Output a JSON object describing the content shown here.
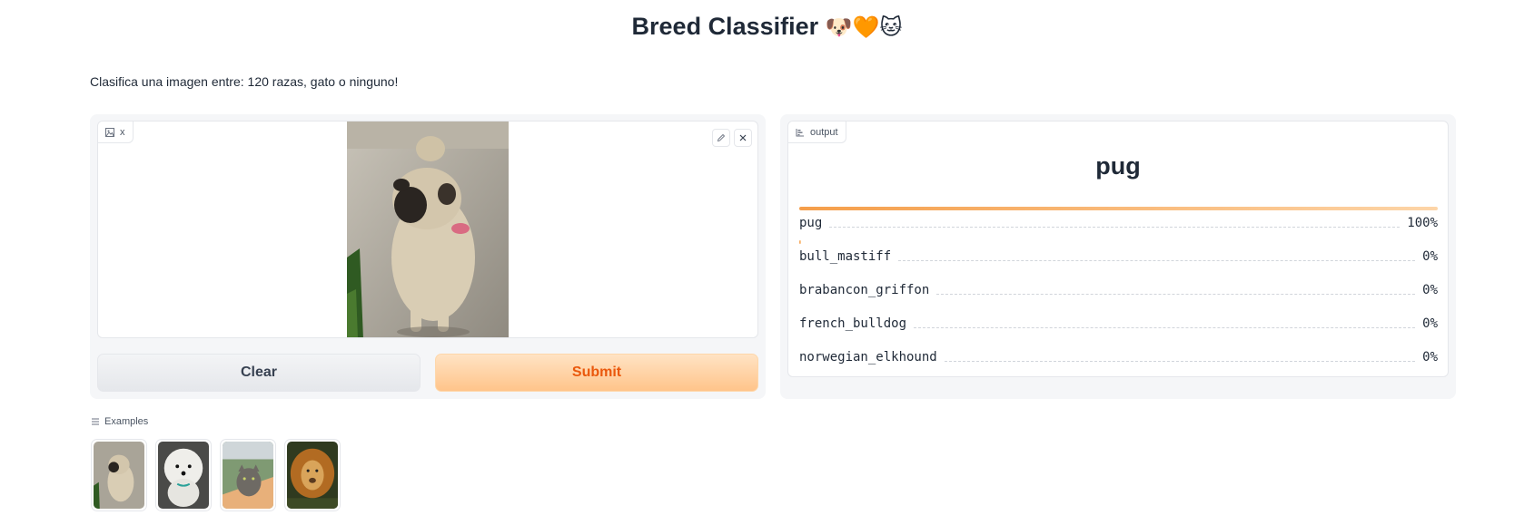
{
  "header": {
    "title": "Breed Classifier",
    "emoji": "🐶🧡🐱"
  },
  "description": "Clasifica una imagen entre: 120 razas, gato o ninguno!",
  "input": {
    "label": "x",
    "edit_icon": "pencil-icon",
    "clear_icon": "close-icon"
  },
  "buttons": {
    "clear": "Clear",
    "submit": "Submit"
  },
  "output": {
    "label": "output",
    "prediction": "pug",
    "confidences": [
      {
        "name": "pug",
        "value": "100%",
        "fraction": 1.0
      },
      {
        "name": "bull_mastiff",
        "value": "0%",
        "fraction": 0.0
      },
      {
        "name": "brabancon_griffon",
        "value": "0%",
        "fraction": 0.0
      },
      {
        "name": "french_bulldog",
        "value": "0%",
        "fraction": 0.0
      },
      {
        "name": "norwegian_elkhound",
        "value": "0%",
        "fraction": 0.0
      }
    ]
  },
  "examples": {
    "label": "Examples",
    "items": [
      "pug",
      "white-dog",
      "cat",
      "lion"
    ]
  },
  "colors": {
    "accent": "#f97316",
    "accent_light": "#ffc48a",
    "panel_bg": "#f5f6f8"
  }
}
